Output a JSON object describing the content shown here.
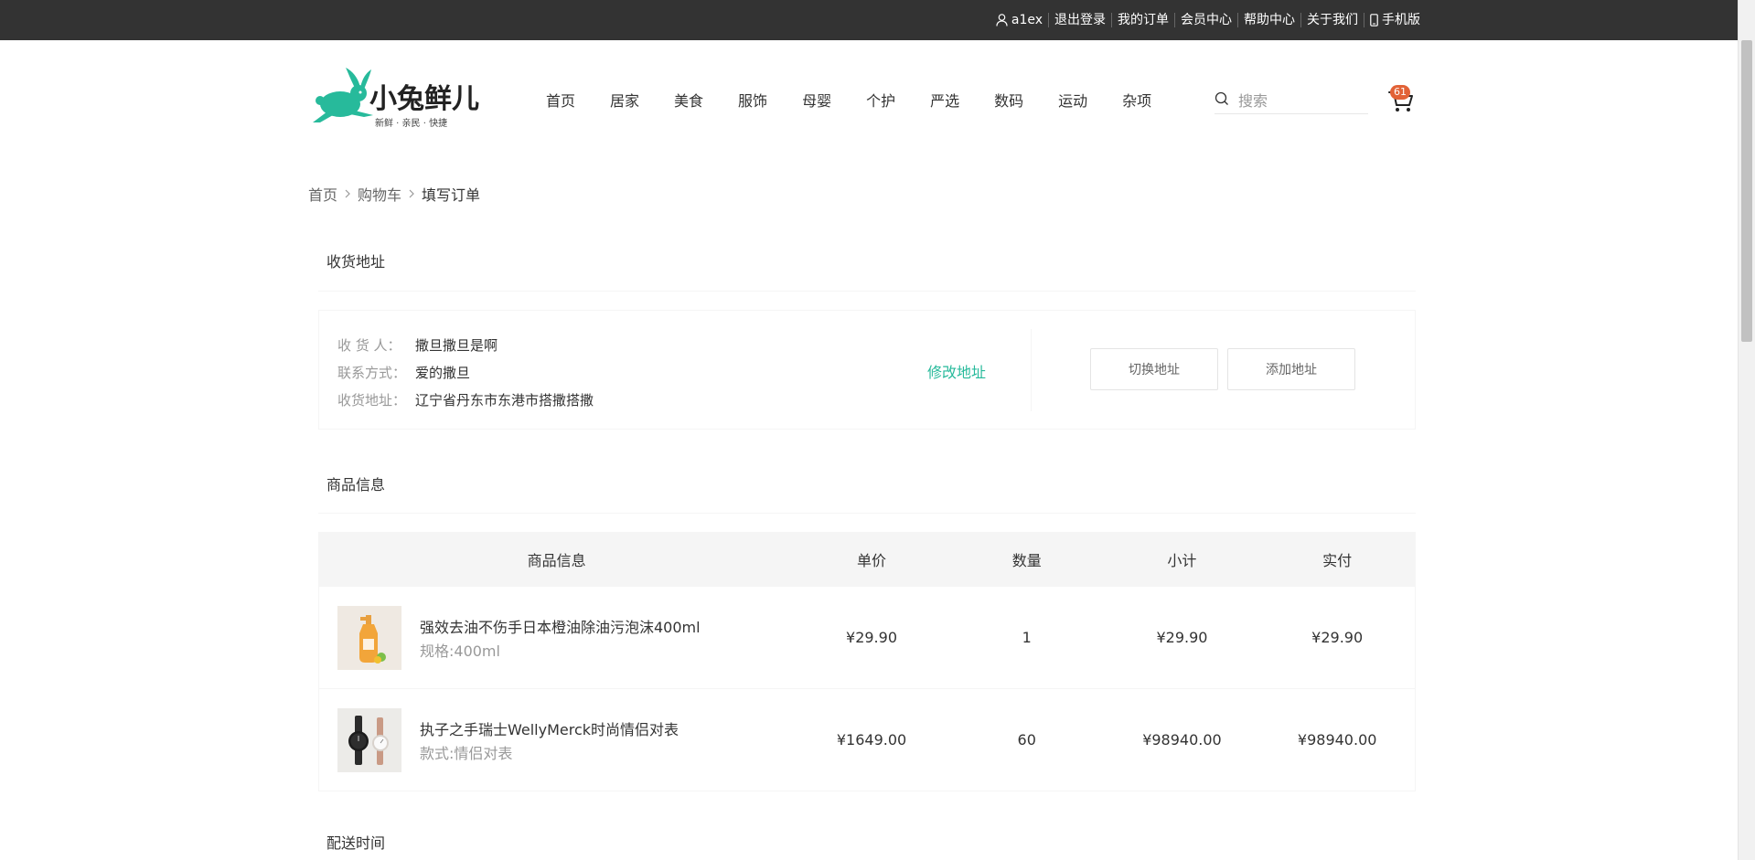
{
  "topbar": {
    "items": [
      {
        "label": "a1ex",
        "icon": "user-icon"
      },
      {
        "label": "退出登录"
      },
      {
        "label": "我的订单"
      },
      {
        "label": "会员中心"
      },
      {
        "label": "帮助中心"
      },
      {
        "label": "关于我们"
      },
      {
        "label": "手机版",
        "icon": "phone-icon"
      }
    ]
  },
  "header": {
    "logo": {
      "title": "小兔鲜儿",
      "slogan": "新鲜 · 亲民 · 快捷",
      "color": "#27ba9b"
    },
    "nav": [
      "首页",
      "居家",
      "美食",
      "服饰",
      "母婴",
      "个护",
      "严选",
      "数码",
      "运动",
      "杂项"
    ],
    "search": {
      "placeholder": "搜索",
      "icon": "search-icon"
    },
    "cart": {
      "count": "61",
      "icon": "cart-icon"
    }
  },
  "breadcrumb": [
    "首页",
    "购物车",
    "填写订单"
  ],
  "address_section": {
    "title": "收货地址",
    "receiver_label": "收 货 人：",
    "receiver": "撒旦撒旦是啊",
    "phone_label": "联系方式：",
    "phone": "爱的撒旦",
    "address_label": "收货地址：",
    "address": "辽宁省丹东市东港市搭撒搭撒",
    "edit_label": "修改地址",
    "switch_label": "切换地址",
    "add_label": "添加地址"
  },
  "goods_section": {
    "title": "商品信息",
    "columns": [
      "商品信息",
      "单价",
      "数量",
      "小计",
      "实付"
    ],
    "rows": [
      {
        "name": "强效去油不伤手日本橙油除油污泡沫400ml",
        "attr": "规格:400ml",
        "price": "¥29.90",
        "qty": "1",
        "subtotal": "¥29.90",
        "paid": "¥29.90"
      },
      {
        "name": "执子之手瑞士WellyMerck时尚情侣对表",
        "attr": "款式:情侣对表",
        "price": "¥1649.00",
        "qty": "60",
        "subtotal": "¥98940.00",
        "paid": "¥98940.00"
      }
    ]
  },
  "delivery_section": {
    "title": "配送时间"
  },
  "colors": {
    "topbar": "#333333",
    "accent": "#27ba9b",
    "badge": "#e26237"
  }
}
